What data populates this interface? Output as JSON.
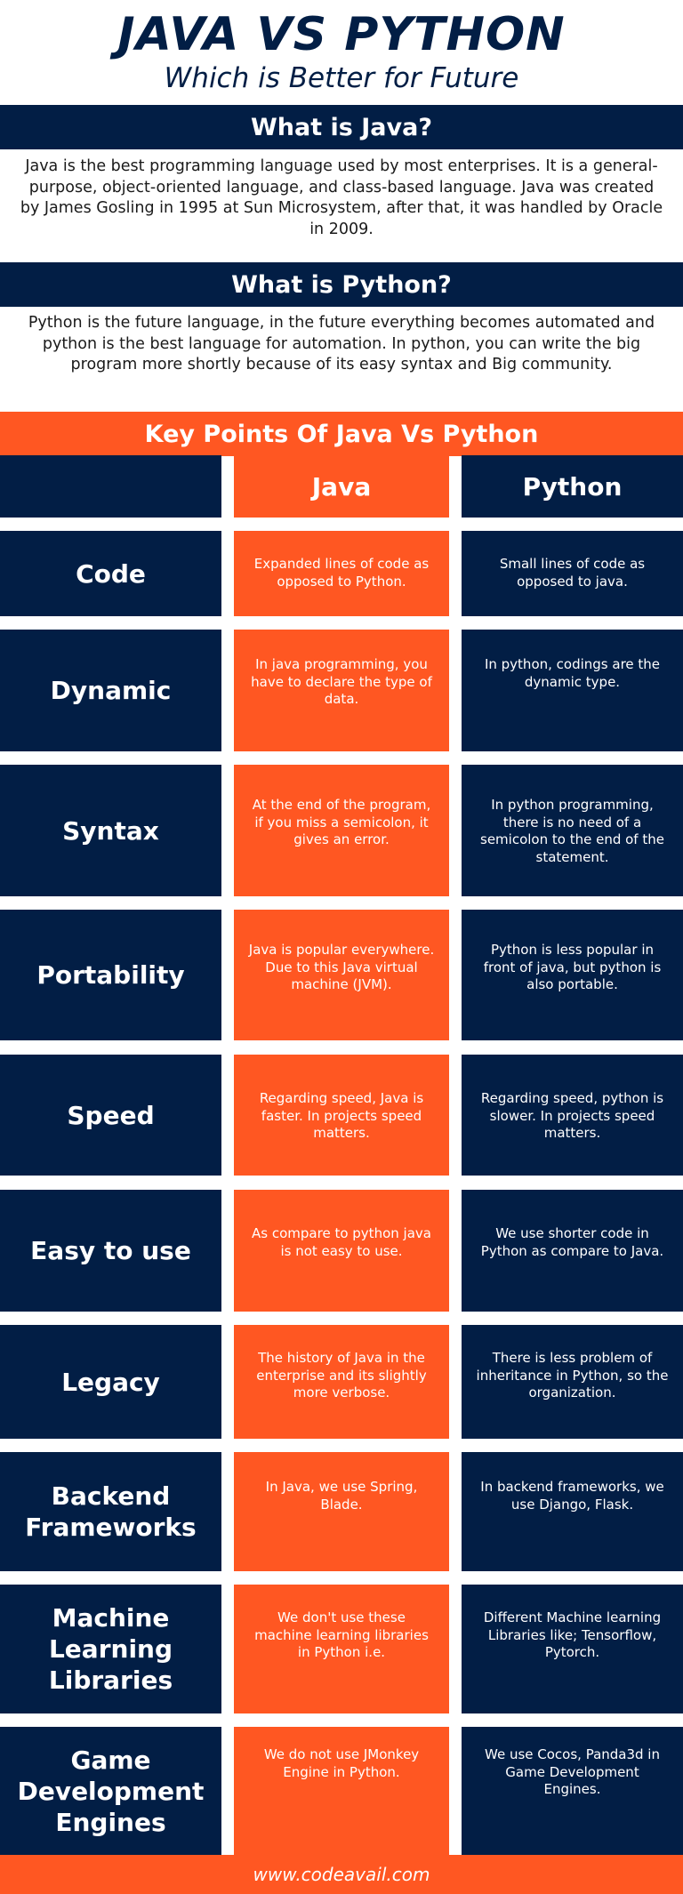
{
  "header": {
    "title": "JAVA VS PYTHON",
    "subtitle": "Which is Better for Future"
  },
  "java_section": {
    "heading": "What is Java?",
    "body": "Java is the best programming language used by most enterprises. It is a general-purpose, object-oriented language, and class-based language. Java was created by James Gosling in 1995 at Sun Microsystem, after that, it was handled by Oracle in 2009."
  },
  "python_section": {
    "heading": "What is Python?",
    "body": "Python is the future language, in the future everything becomes automated and python is the best language for automation. In python, you can write the big program more shortly because of its easy syntax and Big community."
  },
  "comparison": {
    "heading": "Key Points Of Java Vs Python",
    "columns": [
      "",
      "Java",
      "Python"
    ],
    "rows": [
      {
        "label": "Code",
        "java": "Expanded lines of code as opposed to Python.",
        "python": "Small lines of code as opposed to java."
      },
      {
        "label": "Dynamic",
        "java": "In java programming, you have to declare the type of data.",
        "python": "In python, codings are the dynamic type."
      },
      {
        "label": "Syntax",
        "java": "At the end of the program, if you miss a semicolon, it gives an error.",
        "python": "In python programming, there is no need of a semicolon to the end of the statement."
      },
      {
        "label": "Portability",
        "java": "Java is popular everywhere. Due to this Java virtual machine (JVM).",
        "python": "Python is less popular in front of java, but python is also portable."
      },
      {
        "label": "Speed",
        "java": "Regarding speed, Java is faster. In projects speed matters.",
        "python": "Regarding speed, python is slower. In projects speed matters."
      },
      {
        "label": "Easy to use",
        "java": "As compare to python java is not easy to use.",
        "python": "We use shorter code in Python as compare to Java."
      },
      {
        "label": "Legacy",
        "java": "The history of Java in the enterprise and its slightly more verbose.",
        "python": "There is less problem of inheritance in Python, so the organization."
      },
      {
        "label": "Backend Frameworks",
        "java": "In Java, we use Spring, Blade.",
        "python": "In backend frameworks, we use Django, Flask."
      },
      {
        "label": "Machine Learning Libraries",
        "java": "We don't use these machine learning libraries in Python i.e.",
        "python": "Different Machine learning Libraries like; Tensorflow, Pytorch."
      },
      {
        "label": "Game Development Engines",
        "java": "We do not use JMonkey Engine in Python.",
        "python": "We use Cocos, Panda3d in Game Development Engines."
      }
    ]
  },
  "footer": {
    "website": "www.codeavail.com"
  },
  "colors": {
    "navy": "#021e45",
    "orange": "#ff5722",
    "white": "#ffffff"
  }
}
